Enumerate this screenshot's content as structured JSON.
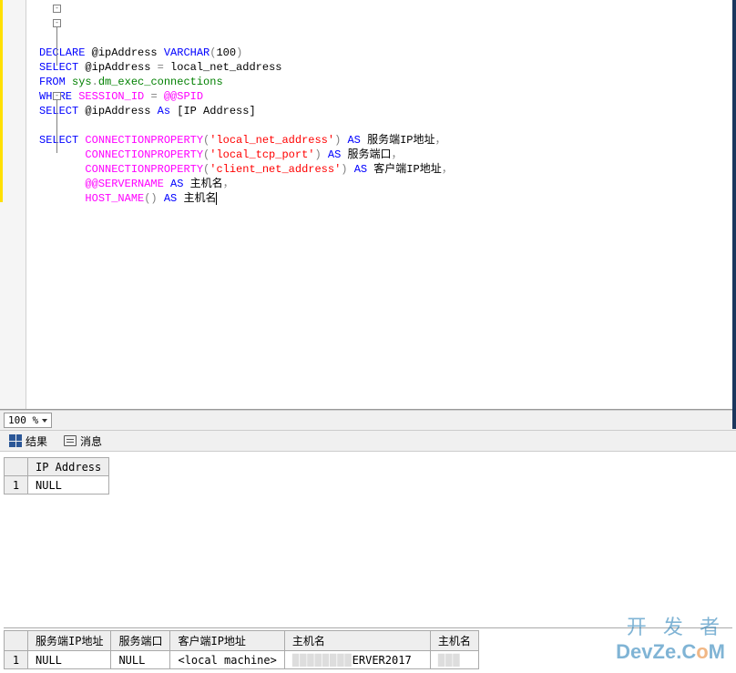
{
  "zoom": {
    "value": "100 %"
  },
  "code": {
    "lines": [
      {
        "type": "decl",
        "segments": [
          [
            "kw",
            "DECLARE"
          ],
          [
            "txt",
            " "
          ],
          [
            "var",
            "@ipAddress"
          ],
          [
            "txt",
            " "
          ],
          [
            "kw",
            "VARCHAR"
          ],
          [
            "op",
            "("
          ],
          [
            "txt",
            "100"
          ],
          [
            "op",
            ")"
          ]
        ]
      },
      {
        "type": "sel",
        "segments": [
          [
            "kw",
            "SELECT"
          ],
          [
            "txt",
            " "
          ],
          [
            "var",
            "@ipAddress"
          ],
          [
            "txt",
            " "
          ],
          [
            "op",
            "="
          ],
          [
            "txt",
            " local_net_address"
          ]
        ]
      },
      {
        "type": "plain",
        "segments": [
          [
            "kw",
            "FROM"
          ],
          [
            "txt",
            " "
          ],
          [
            "sys",
            "sys"
          ],
          [
            "op",
            "."
          ],
          [
            "sys",
            "dm_exec_connections"
          ]
        ]
      },
      {
        "type": "plain",
        "segments": [
          [
            "kw",
            "WHERE"
          ],
          [
            "txt",
            " "
          ],
          [
            "func",
            "SESSION_ID"
          ],
          [
            "txt",
            " "
          ],
          [
            "op",
            "="
          ],
          [
            "txt",
            " "
          ],
          [
            "func",
            "@@SPID"
          ]
        ]
      },
      {
        "type": "plain",
        "segments": [
          [
            "kw",
            "SELECT"
          ],
          [
            "txt",
            " "
          ],
          [
            "var",
            "@ipAddress"
          ],
          [
            "txt",
            " "
          ],
          [
            "kw",
            "As"
          ],
          [
            "txt",
            " [IP Address]"
          ]
        ]
      },
      {
        "type": "blank",
        "segments": []
      },
      {
        "type": "sel",
        "segments": [
          [
            "kw",
            "SELECT"
          ],
          [
            "txt",
            " "
          ],
          [
            "func",
            "CONNECTIONPROPERTY"
          ],
          [
            "op",
            "("
          ],
          [
            "str",
            "'local_net_address'"
          ],
          [
            "op",
            ")"
          ],
          [
            "txt",
            " "
          ],
          [
            "kw",
            "AS"
          ],
          [
            "txt",
            " 服务端IP地址"
          ],
          [
            "op",
            "，"
          ]
        ]
      },
      {
        "type": "plain",
        "indent": 7,
        "segments": [
          [
            "func",
            "CONNECTIONPROPERTY"
          ],
          [
            "op",
            "("
          ],
          [
            "str",
            "'local_tcp_port'"
          ],
          [
            "op",
            ")"
          ],
          [
            "txt",
            " "
          ],
          [
            "kw",
            "AS"
          ],
          [
            "txt",
            " 服务端口"
          ],
          [
            "op",
            "，"
          ]
        ]
      },
      {
        "type": "plain",
        "indent": 7,
        "segments": [
          [
            "func",
            "CONNECTIONPROPERTY"
          ],
          [
            "op",
            "("
          ],
          [
            "str",
            "'client_net_address'"
          ],
          [
            "op",
            ")"
          ],
          [
            "txt",
            " "
          ],
          [
            "kw",
            "AS"
          ],
          [
            "txt",
            " 客户端IP地址"
          ],
          [
            "op",
            "，"
          ]
        ]
      },
      {
        "type": "plain",
        "indent": 7,
        "segments": [
          [
            "func",
            "@@SERVERNAME"
          ],
          [
            "txt",
            " "
          ],
          [
            "kw",
            "AS"
          ],
          [
            "txt",
            " 主机名"
          ],
          [
            "op",
            "，"
          ]
        ]
      },
      {
        "type": "plain",
        "indent": 7,
        "caret": true,
        "segments": [
          [
            "func",
            "HOST_NAME"
          ],
          [
            "op",
            "()"
          ],
          [
            "txt",
            " "
          ],
          [
            "kw",
            "AS"
          ],
          [
            "txt",
            " 主机名"
          ]
        ]
      }
    ]
  },
  "tabs": {
    "results_label": "结果",
    "messages_label": "消息"
  },
  "grid1": {
    "columns": [
      "IP Address"
    ],
    "rows": [
      {
        "n": "1",
        "cells": [
          "NULL"
        ]
      }
    ]
  },
  "grid2": {
    "columns": [
      "服务端IP地址",
      "服务端口",
      "客户端IP地址",
      "主机名",
      "主机名"
    ],
    "rows": [
      {
        "n": "1",
        "cells": [
          "NULL",
          "NULL",
          "<local machine>",
          "██████ERVER2017",
          "███"
        ]
      }
    ]
  },
  "watermark": {
    "line1": "开 发 者",
    "line2_pre": "DevZe.C",
    "line2_o": "o",
    "line2_post": "M"
  }
}
